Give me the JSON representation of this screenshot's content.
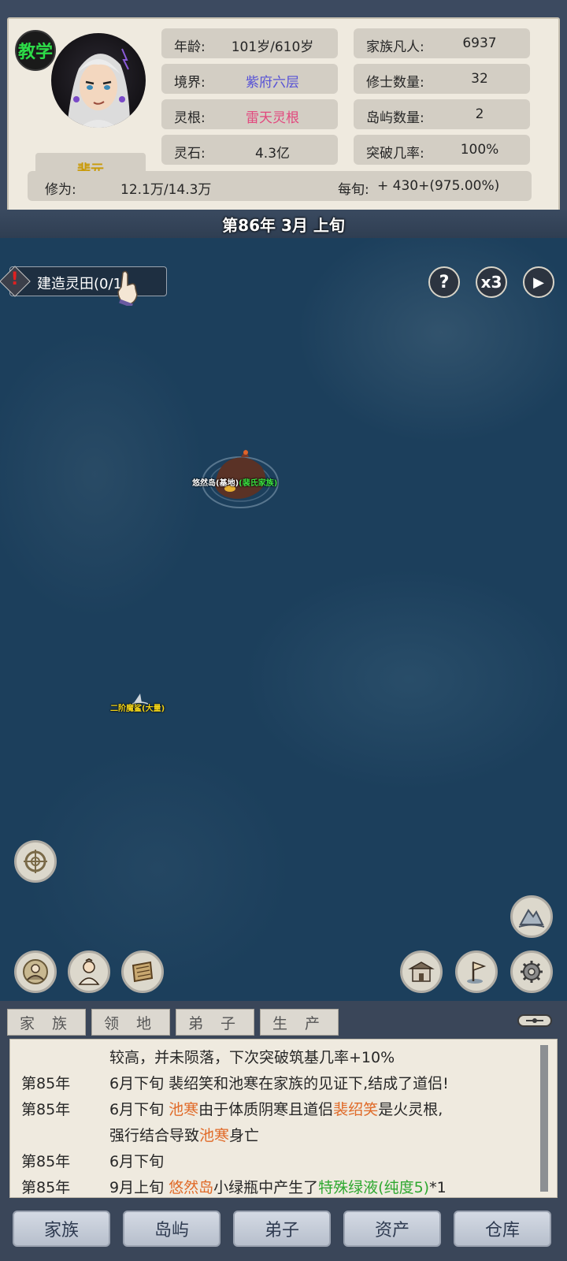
{
  "teach_badge": "教学",
  "character": {
    "name": "裴元"
  },
  "stats": {
    "age_label": "年龄:",
    "age_value": "101岁/610岁",
    "clan_mortals_label": "家族凡人:",
    "clan_mortals_value": "6937",
    "realm_label": "境界:",
    "realm_value": "紫府六层",
    "cultivators_label": "修士数量:",
    "cultivators_value": "32",
    "root_label": "灵根:",
    "root_value": "雷天灵根",
    "islands_label": "岛屿数量:",
    "islands_value": "2",
    "spirit_stone_label": "灵石:",
    "spirit_stone_value": "4.3亿",
    "breakthrough_label": "突破几率:",
    "breakthrough_value": "100%",
    "cultivation_label": "修为:",
    "cultivation_value": "12.1万/14.3万",
    "per_period_label": "每旬:",
    "per_period_value": "+ 430+(975.00%)"
  },
  "date": "第86年 3月 上旬",
  "quest": {
    "label": "建造灵田(0/1)"
  },
  "controls": {
    "help": "?",
    "speed": "x3",
    "play": "▶"
  },
  "map": {
    "home_island_name": "悠然岛(基地)",
    "home_island_clan": "(裴氏家族)",
    "monster_label": "二阶魔鲨(大量)"
  },
  "tabs": [
    "家 族",
    "领 地",
    "弟 子",
    "生 产"
  ],
  "log": [
    {
      "year": "",
      "parts": [
        {
          "t": "较高，并未陨落，下次突破筑基几率+10%",
          "c": ""
        }
      ]
    },
    {
      "year": "第85年",
      "parts": [
        {
          "t": "6月下旬 裴绍笑和池寒在家族的见证下,结成了道侣!",
          "c": ""
        }
      ]
    },
    {
      "year": "第85年",
      "parts": [
        {
          "t": "6月下旬 ",
          "c": ""
        },
        {
          "t": "池寒",
          "c": "hl-orange"
        },
        {
          "t": "由于体质阴寒且道侣",
          "c": ""
        },
        {
          "t": "裴绍笑",
          "c": "hl-orange"
        },
        {
          "t": "是火灵根,",
          "c": ""
        }
      ]
    },
    {
      "year": "",
      "parts": [
        {
          "t": "强行结合导致",
          "c": ""
        },
        {
          "t": "池寒",
          "c": "hl-orange"
        },
        {
          "t": "身亡",
          "c": ""
        }
      ]
    },
    {
      "year": "第85年",
      "parts": [
        {
          "t": "6月下旬",
          "c": ""
        }
      ]
    },
    {
      "year": "第85年",
      "parts": [
        {
          "t": "9月上旬 ",
          "c": ""
        },
        {
          "t": "悠然岛",
          "c": "hl-orange"
        },
        {
          "t": "小绿瓶中产生了",
          "c": ""
        },
        {
          "t": "特殊绿液(纯度5)",
          "c": "hl-green"
        },
        {
          "t": "*1",
          "c": ""
        }
      ]
    }
  ],
  "nav": [
    "家族",
    "岛屿",
    "弟子",
    "资产",
    "仓库"
  ]
}
